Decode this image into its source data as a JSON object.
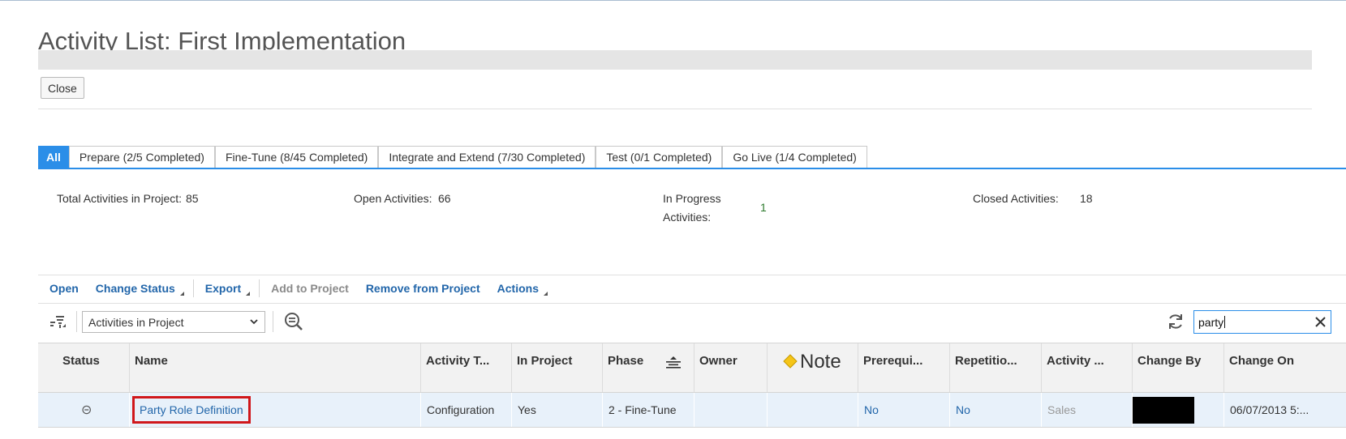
{
  "page": {
    "title": "Activity List: First Implementation"
  },
  "buttons": {
    "close": "Close"
  },
  "tabs": [
    {
      "label": "All"
    },
    {
      "label": "Prepare (2/5 Completed)"
    },
    {
      "label": "Fine-Tune (8/45 Completed)"
    },
    {
      "label": "Integrate and Extend (7/30 Completed)"
    },
    {
      "label": "Test (0/1 Completed)"
    },
    {
      "label": "Go Live (1/4 Completed)"
    }
  ],
  "stats": {
    "total_label": "Total Activities in Project:",
    "total_value": "85",
    "open_label": "Open Activities:",
    "open_value": "66",
    "inprogress_label_1": "In Progress",
    "inprogress_label_2": "Activities:",
    "inprogress_value": "1",
    "closed_label": "Closed Activities:",
    "closed_value": "18"
  },
  "toolbar": {
    "open": "Open",
    "change_status": "Change Status",
    "export": "Export",
    "add_to_project": "Add to Project",
    "remove_from_project": "Remove from Project",
    "actions": "Actions"
  },
  "filter": {
    "selected": "Activities in Project"
  },
  "search": {
    "value": "party"
  },
  "columns": [
    "Status",
    "Name",
    "Activity T...",
    "In Project",
    "Phase",
    "Owner",
    "Note",
    "Prerequi...",
    "Repetitio...",
    "Activity ...",
    "Change By",
    "Change On"
  ],
  "rows": [
    {
      "status": "⊝",
      "name": "Party Role Definition",
      "activity_type": "Configuration",
      "in_project": "Yes",
      "phase": "2 - Fine-Tune",
      "owner": "",
      "note": "",
      "prerequisite": "No",
      "repetition": "No",
      "activity_area": "Sales",
      "change_by": "",
      "change_on": "06/07/2013 5:..."
    }
  ],
  "colors": {
    "accent": "#2b8ee8",
    "link": "#2266aa",
    "highlight": "#d0171b"
  }
}
